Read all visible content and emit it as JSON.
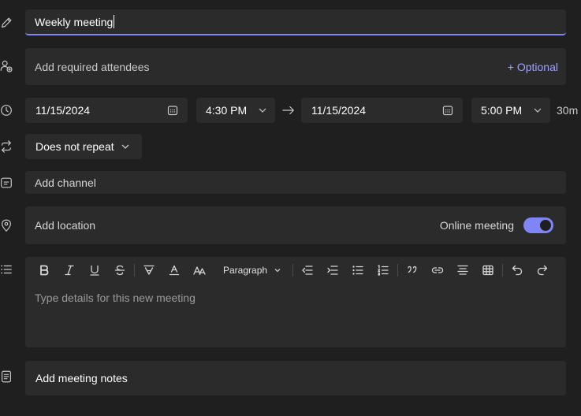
{
  "title": {
    "value": "Weekly meeting"
  },
  "attendees": {
    "placeholder": "Add required attendees",
    "optional_label": "+ Optional"
  },
  "schedule": {
    "start_date": "11/15/2024",
    "start_time": "4:30 PM",
    "end_date": "11/15/2024",
    "end_time": "5:00 PM",
    "duration": "30m"
  },
  "recurrence": {
    "value": "Does not repeat"
  },
  "channel": {
    "placeholder": "Add channel"
  },
  "location": {
    "placeholder": "Add location",
    "online_label": "Online meeting",
    "online_enabled": true
  },
  "editor": {
    "paragraph_style": "Paragraph",
    "placeholder": "Type details for this new meeting",
    "toolbar": [
      "bold-icon",
      "italic-icon",
      "underline-icon",
      "strikethrough-icon",
      "highlight-icon",
      "font-color-icon",
      "font-size-icon",
      "paragraph-dropdown",
      "decrease-indent-icon",
      "increase-indent-icon",
      "bullet-list-icon",
      "numbered-list-icon",
      "quote-icon",
      "link-icon",
      "align-icon",
      "table-icon",
      "undo-icon",
      "redo-icon"
    ]
  },
  "notes": {
    "label": "Add meeting notes"
  },
  "colors": {
    "accent": "#7f85f5",
    "link": "#9ea2ff",
    "background": "#1f1f1f",
    "field": "#2b2b2b"
  }
}
